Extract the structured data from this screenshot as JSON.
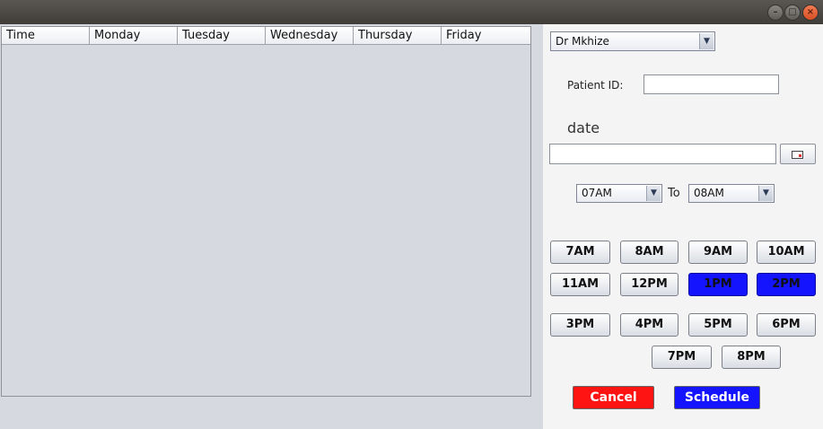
{
  "window": {
    "minimize_icon": "minimize-icon",
    "maximize_icon": "maximize-icon",
    "close_icon": "close-icon"
  },
  "table": {
    "columns": [
      "Time",
      "Monday",
      "Tuesday",
      "Wednesday",
      "Thursday",
      "Friday"
    ],
    "rows": []
  },
  "doctor_select": {
    "value": "Dr Mkhize"
  },
  "patient": {
    "label": "Patient ID:",
    "value": ""
  },
  "date": {
    "label": "date",
    "value": "",
    "picker_icon": "calendar-icon"
  },
  "time_range": {
    "from": "07AM",
    "to_label": "To",
    "to": "08AM"
  },
  "time_slots": [
    {
      "label": "7AM",
      "selected": false
    },
    {
      "label": "8AM",
      "selected": false
    },
    {
      "label": "9AM",
      "selected": false
    },
    {
      "label": "10AM",
      "selected": false
    },
    {
      "label": "11AM",
      "selected": false
    },
    {
      "label": "12PM",
      "selected": false
    },
    {
      "label": "1PM",
      "selected": true
    },
    {
      "label": "2PM",
      "selected": true
    },
    {
      "label": "3PM",
      "selected": false
    },
    {
      "label": "4PM",
      "selected": false
    },
    {
      "label": "5PM",
      "selected": false
    },
    {
      "label": "6PM",
      "selected": false
    },
    {
      "label": "7PM",
      "selected": false
    },
    {
      "label": "8PM",
      "selected": false
    }
  ],
  "actions": {
    "cancel_label": "Cancel",
    "schedule_label": "Schedule",
    "cancel_color": "#ff1414",
    "schedule_color": "#1414ff"
  },
  "colors": {
    "selected_slot": "#1414ff"
  }
}
